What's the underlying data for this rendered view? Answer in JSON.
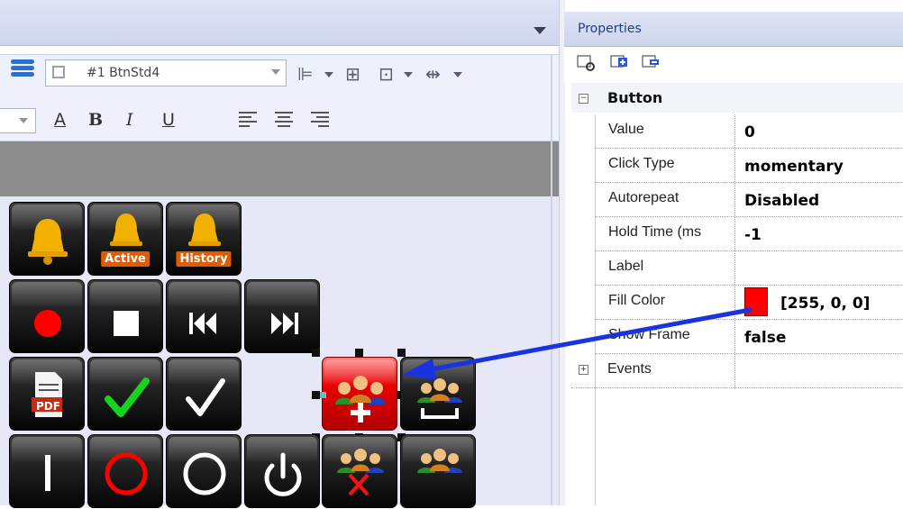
{
  "designer": {
    "object_combo": {
      "value": "#1 BtnStd4"
    },
    "format_toolbar": {
      "bold": "B",
      "italic": "I",
      "underline": "U",
      "font_color_letter": "A"
    },
    "buttons": {
      "alarm_active_badge": "Active",
      "alarm_history_badge": "History",
      "pdf_label": "PDF"
    }
  },
  "properties": {
    "title": "Properties",
    "group_button": "Button",
    "group_events": "Events",
    "rows": [
      {
        "name": "Value",
        "value": "0"
      },
      {
        "name": "Click Type",
        "value": "momentary"
      },
      {
        "name": "Autorepeat",
        "value": "Disabled"
      },
      {
        "name": "Hold Time (ms",
        "value": "-1"
      },
      {
        "name": "Label",
        "value": ""
      },
      {
        "name": "Fill Color",
        "value": "[255, 0, 0]"
      },
      {
        "name": "Show Frame",
        "value": "false"
      }
    ],
    "fill_color_hex": "#ff0000"
  },
  "colors": {
    "annotation_arrow": "#1a33e0",
    "selected_button_fill": "#e80000",
    "panel_title": "#1e3f8f"
  }
}
